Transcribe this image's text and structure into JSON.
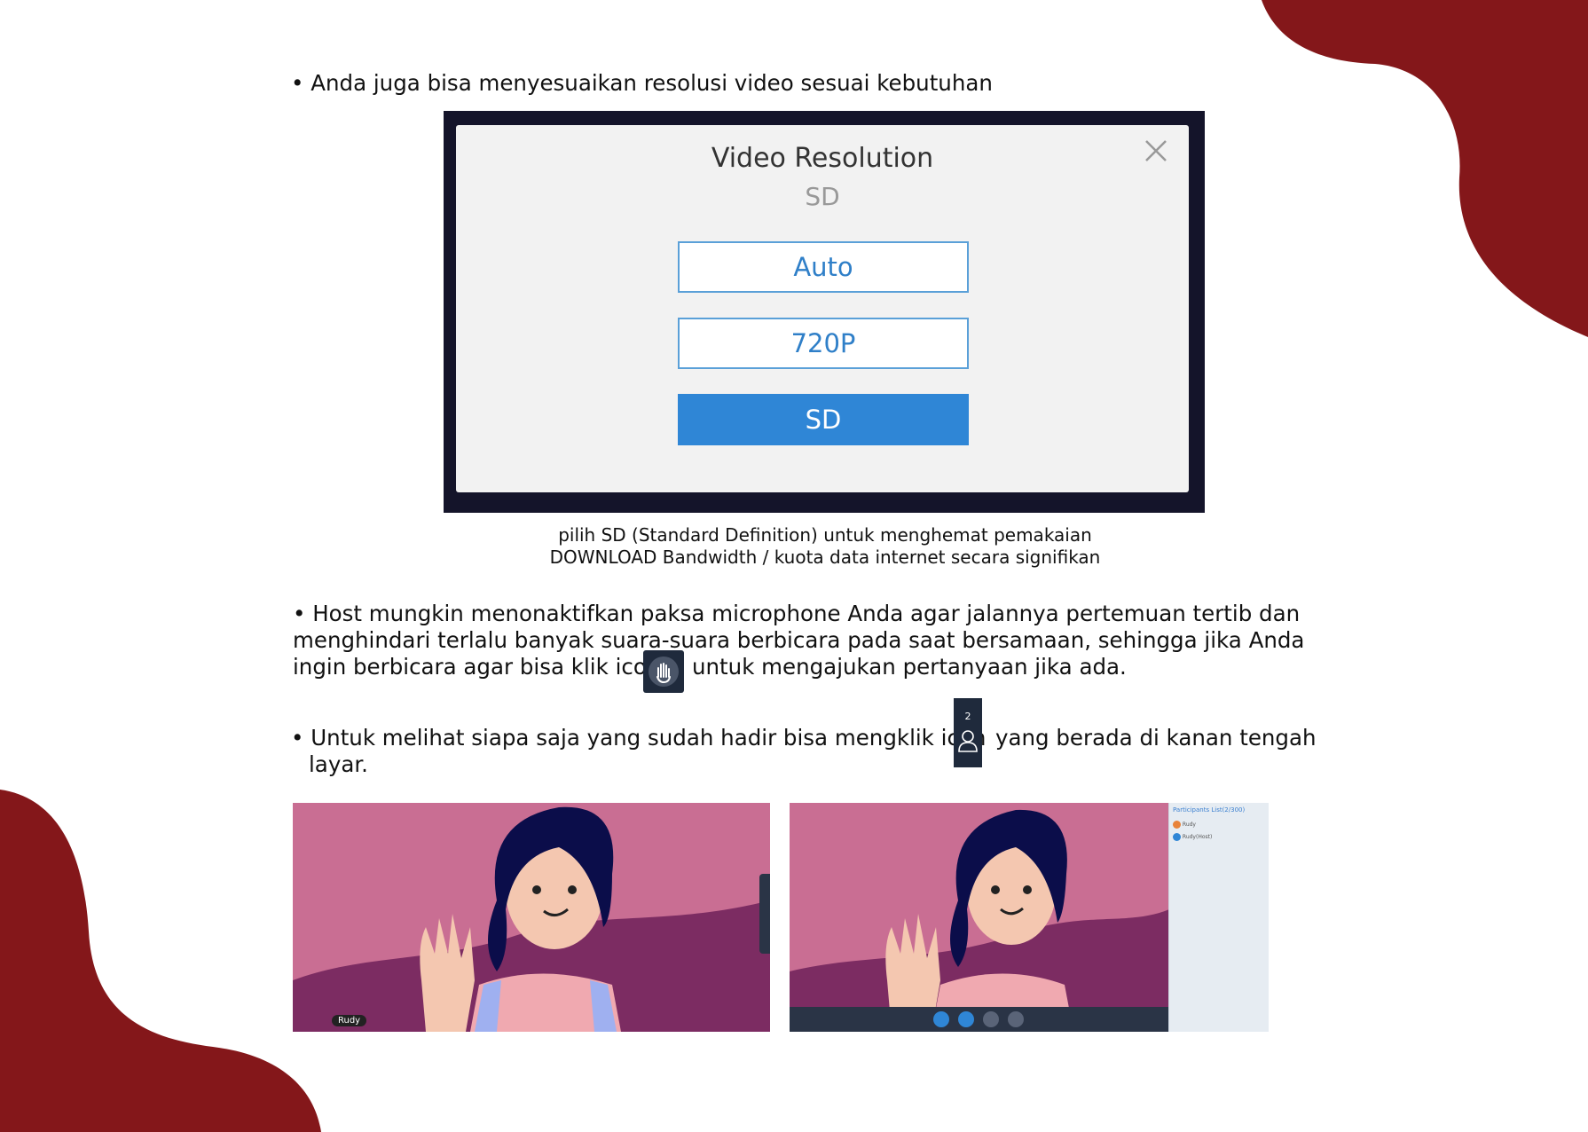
{
  "bullets": {
    "line1": "• Anda juga bisa menyesuaikan resolusi video sesuai kebutuhan",
    "line2a": "• Host mungkin menonaktifkan paksa microphone Anda agar jalannya pertemuan tertib dan",
    "line2b": "menghindari terlalu banyak suara-suara berbicara pada saat bersamaan, sehingga jika Anda",
    "line2c_pre": "ingin berbicara agar bisa klik icon",
    "line2c_post": "untuk mengajukan pertanyaan jika ada.",
    "line3a_pre": "• Untuk melihat siapa saja yang sudah hadir bisa mengklik icon",
    "line3a_post": "yang berada di kanan tengah",
    "line3b": "layar."
  },
  "caption": {
    "line1": "pilih SD (Standard Definition) untuk menghemat pemakaian",
    "line2": "DOWNLOAD Bandwidth / kuota data internet secara signifikan"
  },
  "dialog": {
    "title": "Video Resolution",
    "current": "SD",
    "options": [
      "Auto",
      "720P",
      "SD"
    ],
    "selected": "SD"
  },
  "participant_icon": {
    "count": "2"
  },
  "screenshot1": {
    "name_tag": "Rudy"
  },
  "screenshot2": {
    "panel_title": "Participants List(2/300)",
    "participants": [
      "Rudy",
      "Rudy(Host)"
    ]
  },
  "colors": {
    "accent_red": "#84171a",
    "button_blue": "#2f86d6",
    "bg_pink": "#c96e93"
  }
}
